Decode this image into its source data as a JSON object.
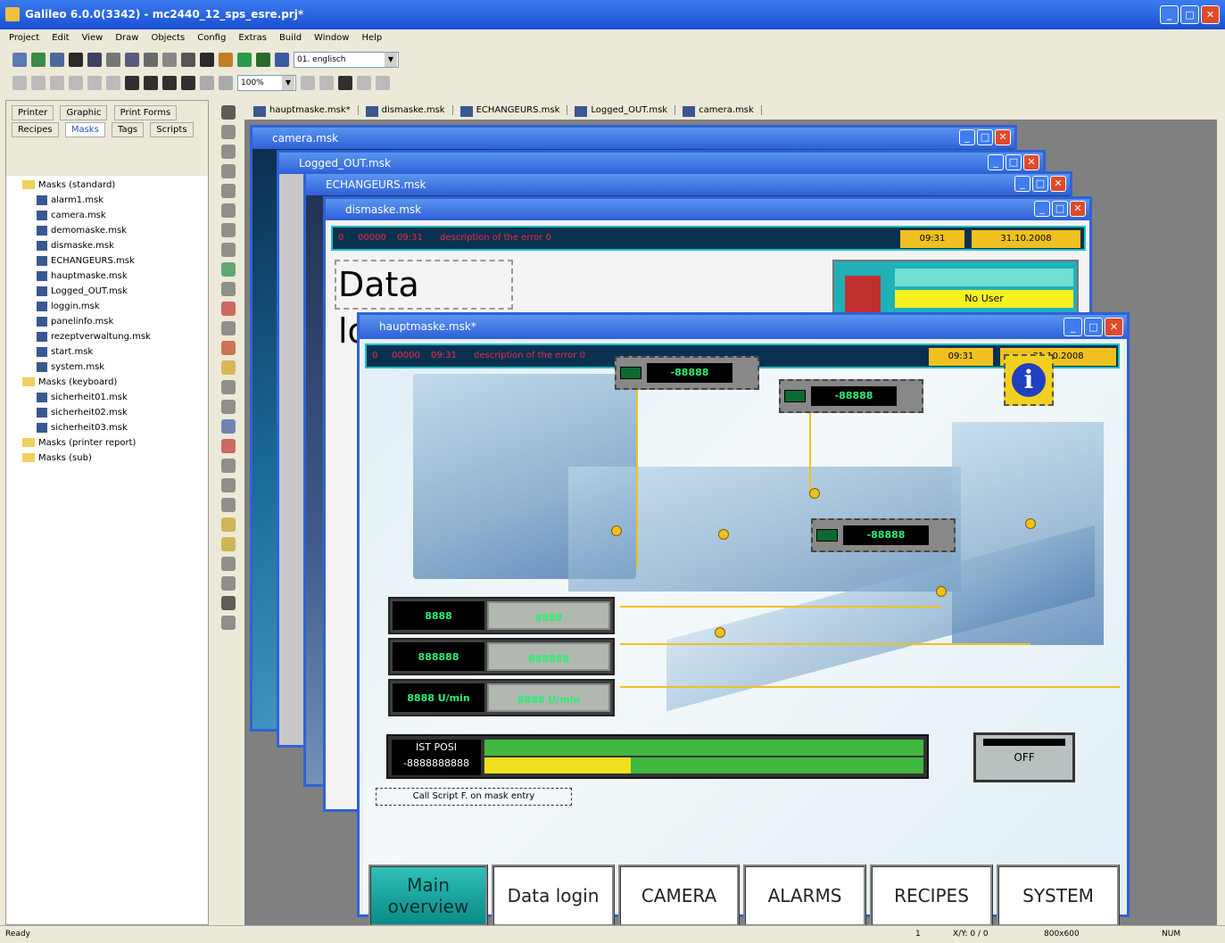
{
  "app": {
    "title": "Galileo 6.0.0(3342) - mc2440_12_sps_esre.prj*"
  },
  "menu": [
    "Project",
    "Edit",
    "View",
    "Draw",
    "Objects",
    "Config",
    "Extras",
    "Build",
    "Window",
    "Help"
  ],
  "toolbar": {
    "language": "01. englisch",
    "zoom": "100%"
  },
  "panel": {
    "tabs": [
      "Printer",
      "Graphic",
      "Print Forms",
      "Recipes",
      "Masks",
      "Tags",
      "Scripts"
    ],
    "folders": [
      {
        "name": "Masks (standard)",
        "items": [
          "alarm1.msk",
          "camera.msk",
          "demomaske.msk",
          "dismaske.msk",
          "ECHANGEURS.msk",
          "hauptmaske.msk",
          "Logged_OUT.msk",
          "loggin.msk",
          "panelinfo.msk",
          "rezeptverwaltung.msk",
          "start.msk",
          "system.msk"
        ]
      },
      {
        "name": "Masks (keyboard)",
        "items": [
          "sicherheit01.msk",
          "sicherheit02.msk",
          "sicherheit03.msk"
        ]
      },
      {
        "name": "Masks (printer report)",
        "items": []
      },
      {
        "name": "Masks (sub)",
        "items": []
      }
    ]
  },
  "tabs": [
    "hauptmaske.msk*",
    "dismaske.msk",
    "ECHANGEURS.msk",
    "Logged_OUT.msk",
    "camera.msk"
  ],
  "windows": {
    "camera": "camera.msk",
    "logged": "Logged_OUT.msk",
    "echangeurs": "ECHANGEURS.msk",
    "dis": "dismaske.msk",
    "haupt": "hauptmaske.msk*"
  },
  "dis": {
    "err_a": "0",
    "err_b": "00000",
    "err_c": "09:31",
    "err_msg": "description of the error 0",
    "time": "09:31",
    "date": "31.10.2008",
    "heading": "Data login",
    "user": "No User"
  },
  "haupt": {
    "err_a": "0",
    "err_b": "00000",
    "err_c": "09:31",
    "err_msg": "description of the error 0",
    "time": "09:31",
    "date": "31.10.2008",
    "display_val": "-88888",
    "io": [
      {
        "l": "8888",
        "r": "8888"
      },
      {
        "l": "888888",
        "r": "888888"
      },
      {
        "l": "8888 U/min",
        "r": "8888 U/min"
      }
    ],
    "pos_label": "IST POSI",
    "pos_value": "-8888888888",
    "off": "OFF",
    "script_note": "Call Script F. on mask entry",
    "nav": [
      {
        "l": "Main overview"
      },
      {
        "l": "Data login"
      },
      {
        "l": "CAMERA"
      },
      {
        "l": "ALARMS"
      },
      {
        "l": "RECIPES"
      },
      {
        "l": "SYSTEM"
      }
    ]
  },
  "status": {
    "left": "Ready",
    "s1": "1",
    "s2": "X/Y: 0 / 0",
    "s3": "800x600",
    "s4": "NUM"
  },
  "colors": {
    "title": "#2f62d8",
    "accent": "#f0c020",
    "display_green": "#2af070"
  }
}
